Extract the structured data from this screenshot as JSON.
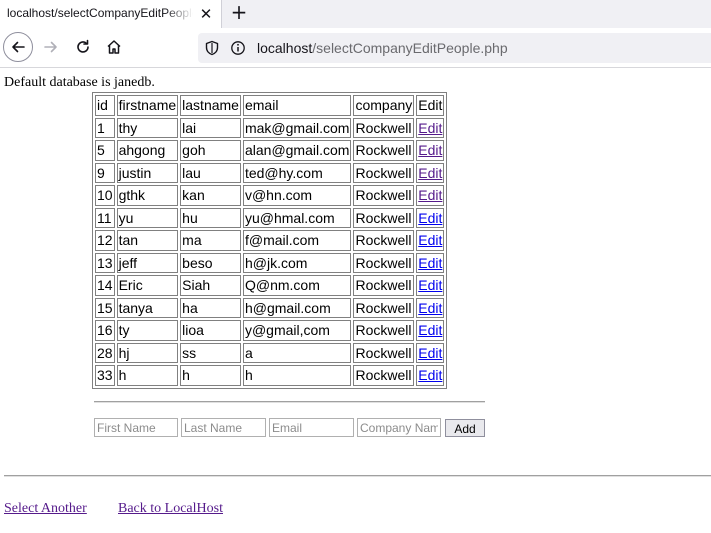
{
  "browser": {
    "tab_title": "localhost/selectCompanyEditPeople.php",
    "tab_close": "✕",
    "new_tab": "+",
    "url_host": "localhost",
    "url_path": "/selectCompanyEditPeople.php"
  },
  "page": {
    "db_line": "Default database is janedb.",
    "table": {
      "headers": [
        "id",
        "firstname",
        "lastname",
        "email",
        "company",
        "Edit"
      ],
      "rows": [
        {
          "id": "1",
          "firstname": "thy",
          "lastname": "lai",
          "email": "mak@gmail.com",
          "company": "Rockwell",
          "edit": "Edit"
        },
        {
          "id": "5",
          "firstname": "ahgong",
          "lastname": "goh",
          "email": "alan@gmail.com",
          "company": "Rockwell",
          "edit": "Edit"
        },
        {
          "id": "9",
          "firstname": "justin",
          "lastname": "lau",
          "email": "ted@hy.com",
          "company": "Rockwell",
          "edit": "Edit"
        },
        {
          "id": "10",
          "firstname": "gthk",
          "lastname": "kan",
          "email": "v@hn.com",
          "company": "Rockwell",
          "edit": "Edit"
        },
        {
          "id": "11",
          "firstname": "yu",
          "lastname": "hu",
          "email": "yu@hmal.com",
          "company": "Rockwell",
          "edit": "Edit"
        },
        {
          "id": "12",
          "firstname": "tan",
          "lastname": "ma",
          "email": "f@mail.com",
          "company": "Rockwell",
          "edit": "Edit"
        },
        {
          "id": "13",
          "firstname": "jeff",
          "lastname": "beso",
          "email": "h@jk.com",
          "company": "Rockwell",
          "edit": "Edit"
        },
        {
          "id": "14",
          "firstname": "Eric",
          "lastname": "Siah",
          "email": "Q@nm.com",
          "company": "Rockwell",
          "edit": "Edit"
        },
        {
          "id": "15",
          "firstname": "tanya",
          "lastname": "ha",
          "email": "h@gmail.com",
          "company": "Rockwell",
          "edit": "Edit"
        },
        {
          "id": "16",
          "firstname": "ty",
          "lastname": "lioa",
          "email": "y@gmail,com",
          "company": "Rockwell",
          "edit": "Edit"
        },
        {
          "id": "28",
          "firstname": "hj",
          "lastname": "ss",
          "email": "a",
          "company": "Rockwell",
          "edit": "Edit"
        },
        {
          "id": "33",
          "firstname": "h",
          "lastname": "h",
          "email": "h",
          "company": "Rockwell",
          "edit": "Edit"
        }
      ],
      "visited_edit_rows": [
        0,
        1,
        2,
        3
      ]
    },
    "add_form": {
      "first_name_placeholder": "First Name",
      "last_name_placeholder": "Last Name",
      "email_placeholder": "Email",
      "company_placeholder": "Company Name",
      "add_label": "Add"
    },
    "links": {
      "select_another": "Select Another",
      "back_to_localhost": "Back to LocalHost"
    }
  },
  "colors": {
    "link": "#0000ee",
    "visited_link": "#551a8b",
    "border": "#808080"
  }
}
